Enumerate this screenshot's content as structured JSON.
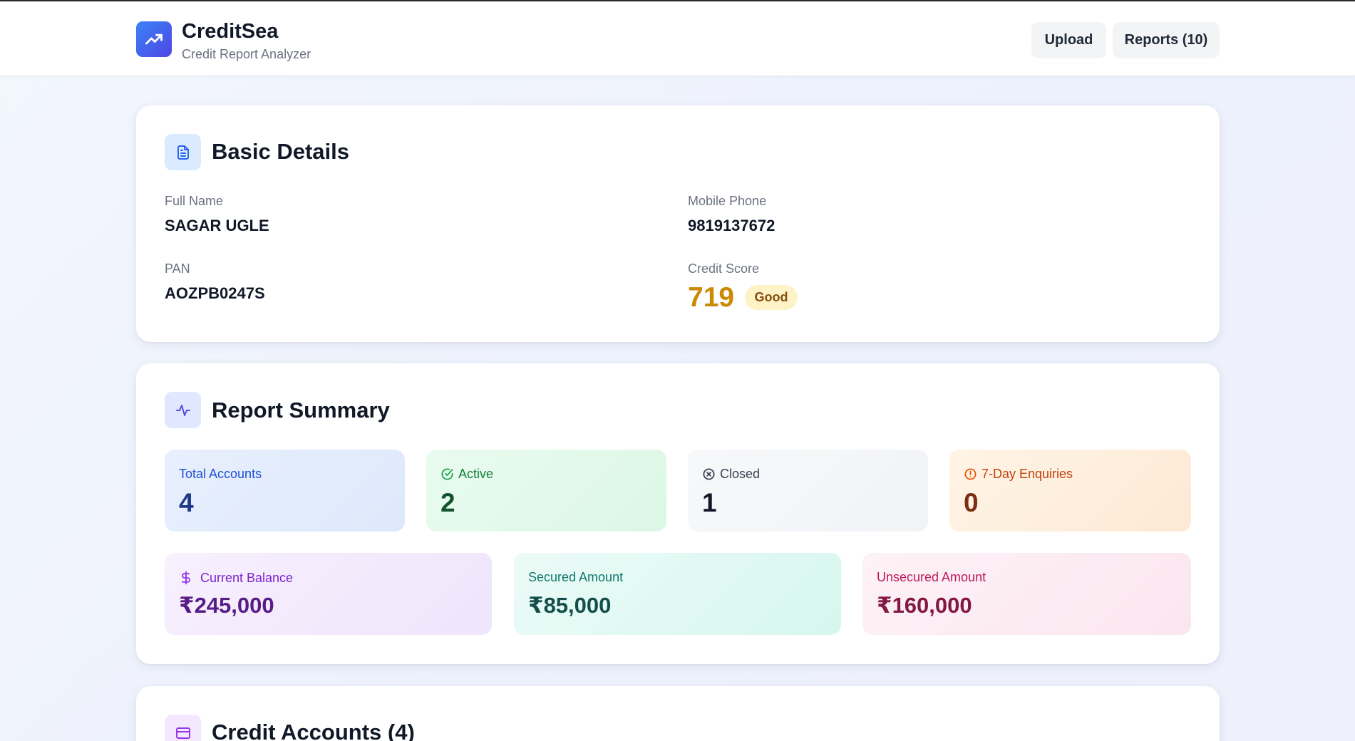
{
  "app": {
    "title": "CreditSea",
    "subtitle": "Credit Report Analyzer",
    "logo_icon": "trending-up-icon",
    "accent": "#4f46e5"
  },
  "header": {
    "upload_label": "Upload",
    "reports_label": "Reports (10)"
  },
  "basic_details": {
    "title": "Basic Details",
    "icon": "document-icon",
    "full_name_label": "Full Name",
    "full_name": "SAGAR UGLE",
    "mobile_label": "Mobile Phone",
    "mobile": "9819137672",
    "pan_label": "PAN",
    "pan": "AOZPB0247S",
    "credit_score_label": "Credit Score",
    "credit_score": "719",
    "credit_score_rating": "Good",
    "score_color": "#ca8a04"
  },
  "report_summary": {
    "title": "Report Summary",
    "icon": "activity-icon",
    "total_accounts_label": "Total Accounts",
    "total_accounts": "4",
    "active_label": "Active",
    "active": "2",
    "closed_label": "Closed",
    "closed": "1",
    "enquiries_label": "7-Day Enquiries",
    "enquiries": "0",
    "current_balance_label": "Current Balance",
    "current_balance": "₹245,000",
    "secured_label": "Secured Amount",
    "secured": "₹85,000",
    "unsecured_label": "Unsecured Amount",
    "unsecured": "₹160,000"
  },
  "credit_accounts": {
    "title": "Credit Accounts (4)",
    "icon": "credit-card-icon"
  }
}
